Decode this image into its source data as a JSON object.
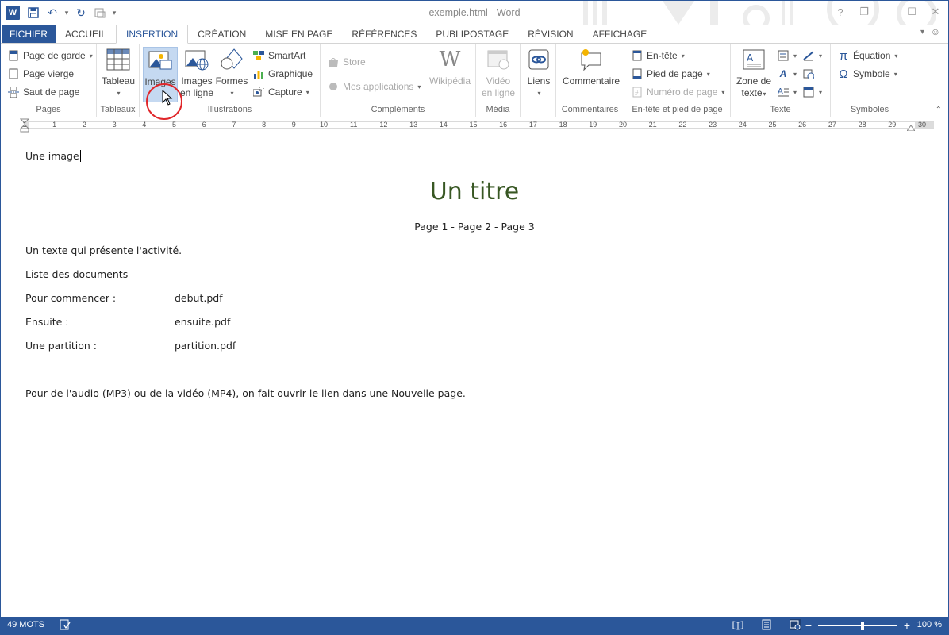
{
  "window": {
    "title": "exemple.html - Word",
    "controls": [
      "?",
      "❐",
      "—",
      "☐",
      "✕"
    ]
  },
  "tabs": [
    {
      "label": "FICHIER"
    },
    {
      "label": "ACCUEIL"
    },
    {
      "label": "INSERTION"
    },
    {
      "label": "CRÉATION"
    },
    {
      "label": "MISE EN PAGE"
    },
    {
      "label": "RÉFÉRENCES"
    },
    {
      "label": "PUBLIPOSTAGE"
    },
    {
      "label": "RÉVISION"
    },
    {
      "label": "AFFICHAGE"
    }
  ],
  "ribbon": {
    "pages": {
      "label": "Pages",
      "items": [
        "Page de garde",
        "Page vierge",
        "Saut de page"
      ]
    },
    "tableaux": {
      "label": "Tableaux",
      "items": [
        "Tableau"
      ]
    },
    "illustrations": {
      "label": "Illustrations",
      "images": "Images",
      "images_en_ligne_1": "Images",
      "images_en_ligne_2": "en ligne",
      "formes": "Formes",
      "smartart": "SmartArt",
      "graphique": "Graphique",
      "capture": "Capture"
    },
    "complements": {
      "label": "Compléments",
      "store": "Store",
      "mes_applications": "Mes applications",
      "wikipedia": "Wikipédia"
    },
    "media": {
      "label": "Média",
      "video_1": "Vidéo",
      "video_2": "en ligne"
    },
    "liens": {
      "label": "",
      "liens": "Liens"
    },
    "commentaires": {
      "label": "Commentaires",
      "commentaire": "Commentaire"
    },
    "entete": {
      "label": "En-tête et pied de page",
      "entete": "En-tête",
      "pied": "Pied de page",
      "numero": "Numéro de page"
    },
    "texte": {
      "label": "Texte",
      "zone_1": "Zone de",
      "zone_2": "texte"
    },
    "symboles": {
      "label": "Symboles",
      "equation": "Équation",
      "symbole": "Symbole"
    }
  },
  "ruler": {
    "numbers": [
      "2",
      "1",
      "1",
      "2",
      "3",
      "4",
      "5",
      "6",
      "7",
      "8",
      "9",
      "10",
      "11",
      "12",
      "13",
      "14",
      "15",
      "16",
      "17",
      "18",
      "19",
      "20",
      "21",
      "22",
      "23",
      "24",
      "25",
      "26",
      "27",
      "28",
      "29",
      "30"
    ]
  },
  "document": {
    "line1": "Une image",
    "title": "Un titre",
    "pages": "Page 1  -  Page 2 -  Page 3",
    "intro": "Un texte qui présente l'activité.",
    "liste": "Liste des documents",
    "rows": [
      {
        "label": "Pour commencer :",
        "file": "debut.pdf"
      },
      {
        "label": "Ensuite :",
        "file": "ensuite.pdf"
      },
      {
        "label": "Une partition :",
        "file": "partition.pdf"
      }
    ],
    "footer": "Pour de l'audio (MP3) ou de la vidéo (MP4), on fait ouvrir le lien dans une Nouvelle page."
  },
  "status": {
    "words": "49 MOTS",
    "zoom": "100 %"
  },
  "colors": {
    "accent": "#2b579a",
    "title_green": "#385723",
    "highlight": "#e0262a"
  }
}
